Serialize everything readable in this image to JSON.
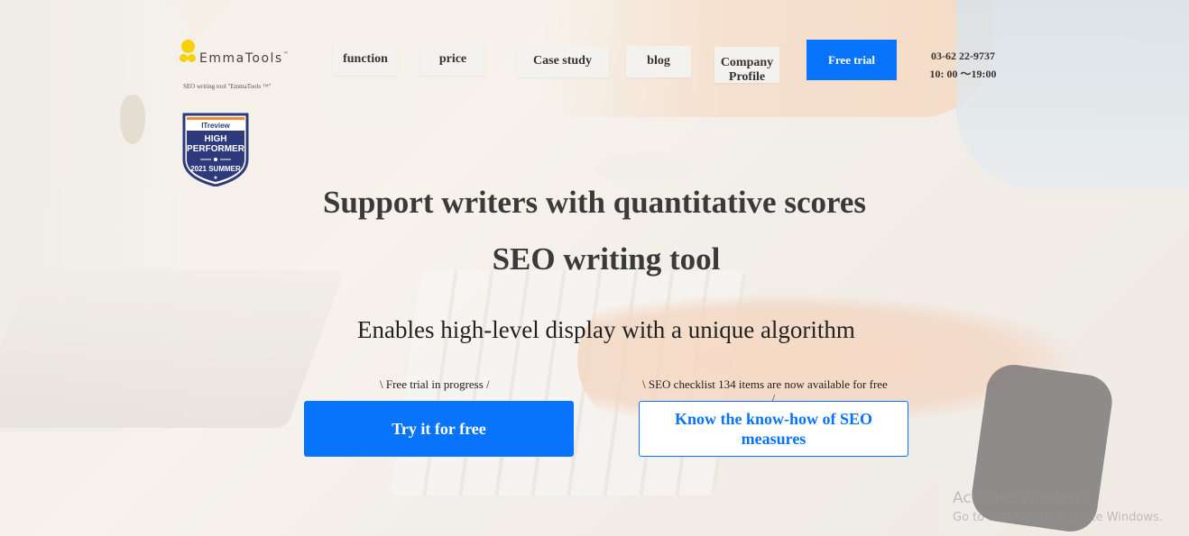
{
  "brand": {
    "logo_text": "EmmaTools",
    "logo_tm": "™",
    "tagline": "SEO writing tool \"EmmaTools ™\""
  },
  "badge": {
    "brand": "ITreview",
    "line1": "HIGH",
    "line2": "PERFORMER",
    "line3": "2021 SUMMER"
  },
  "nav": {
    "function": "function",
    "price": "price",
    "case_study": "Case study",
    "blog": "blog",
    "company_profile": "Company Profile",
    "free_trial": "Free trial"
  },
  "contact": {
    "phone": "03-62 22-9737",
    "hours": "10: 00 ～19:00"
  },
  "hero": {
    "title_line1": "Support writers with quantitative scores",
    "title_line2": "SEO writing tool",
    "subtitle": "Enables high-level display with a unique algorithm"
  },
  "cta": {
    "left_note": "\\ Free trial in progress /",
    "right_note": "\\ SEO checklist 134 items are now available for free",
    "right_note_slash": "/",
    "try_label": "Try it for free",
    "know_label": "Know the know-how of SEO measures"
  },
  "os_watermark": {
    "line1": "Activate Windows",
    "line2": "Go to Settings to activate Windows."
  },
  "colors": {
    "accent": "#0874fc",
    "logo_yellow": "#f5d200",
    "badge_navy": "#2d3a7c",
    "badge_orange": "#f08a2a"
  }
}
